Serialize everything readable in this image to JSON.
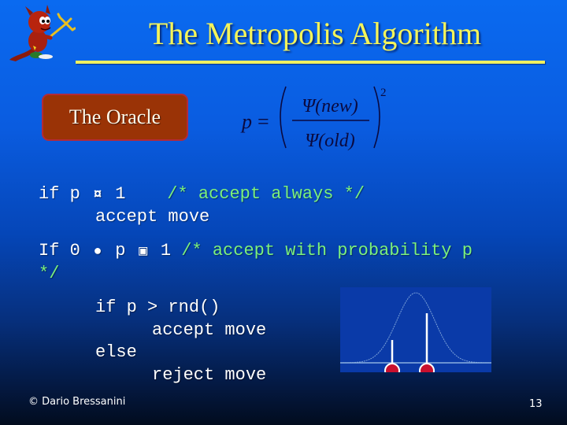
{
  "slide": {
    "title": "The Metropolis Algorithm",
    "mascot_icon": "bsd-daemon-with-trident",
    "oracle_label": "The Oracle",
    "formula": {
      "lhs": "p",
      "equals": "=",
      "numerator": "Ψ(new)",
      "denominator": "Ψ(old)",
      "exponent": "2"
    },
    "code": {
      "line1_kw": "if p",
      "line1_sym": "¤",
      "line1_val": "1",
      "line1_comment": "/* accept always */",
      "line2": "accept move",
      "line3_kw": "If 0",
      "line3_sym1": "●",
      "line3_mid": "p",
      "line3_sym2": "▣",
      "line3_val": "1",
      "line3_comment": "/* accept with probability p",
      "line4_comment": "*/",
      "line5": "if p > rnd()",
      "line6": "accept move",
      "line7": "else",
      "line8": "reject move"
    },
    "figure": {
      "description": "gaussian-curve-with-two-samples",
      "samples": [
        {
          "x_position": "left-of-peak",
          "marker_color": "#c8102e"
        },
        {
          "x_position": "right-of-peak",
          "marker_color": "#c8102e"
        }
      ]
    },
    "footer": {
      "copyright": "© Dario Bressanini",
      "page_number": "13"
    },
    "colors": {
      "title": "#f4f45a",
      "comment": "#7cf07c",
      "oracle_bg": "#9a3306"
    }
  }
}
